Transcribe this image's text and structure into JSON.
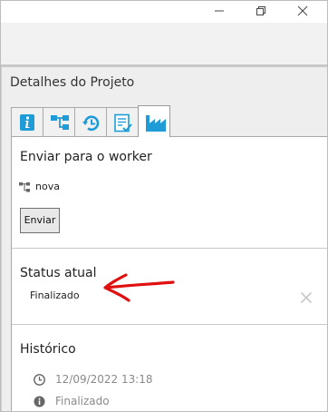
{
  "window_controls": {
    "minimize_icon": "minimize-icon",
    "maximize_icon": "restore-icon",
    "close_icon": "close-icon"
  },
  "panel": {
    "title": "Detalhes do Projeto",
    "tabs": [
      {
        "icon": "info-icon",
        "active": false
      },
      {
        "icon": "workflow-icon",
        "active": false
      },
      {
        "icon": "history-icon",
        "active": false
      },
      {
        "icon": "checklist-icon",
        "active": false
      },
      {
        "icon": "factory-icon",
        "active": true
      }
    ]
  },
  "send_section": {
    "title": "Enviar para o worker",
    "worker_name": "nova",
    "send_button": "Enviar"
  },
  "status_section": {
    "title": "Status atual",
    "value": "Finalizado"
  },
  "history_section": {
    "title": "Histórico",
    "entries": [
      {
        "icon": "clock-icon",
        "text": "12/09/2022 13:18"
      },
      {
        "icon": "info-circle-icon",
        "text": "Finalizado"
      }
    ]
  },
  "colors": {
    "annotation_arrow": "#e01010",
    "tab_icon_blue": "#1f9bd7"
  }
}
